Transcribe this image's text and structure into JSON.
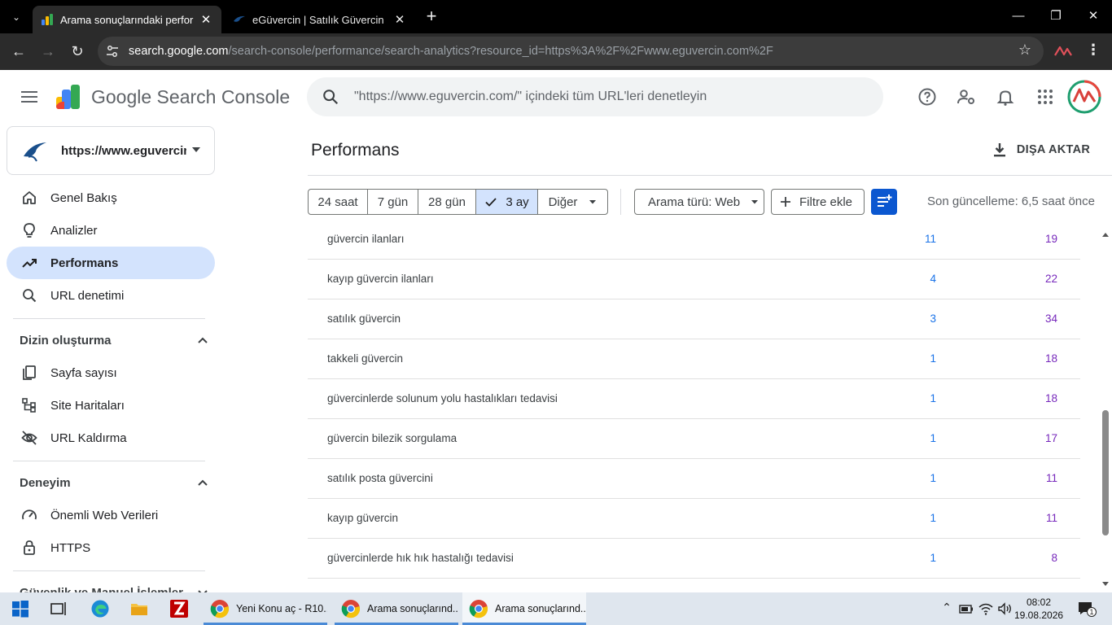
{
  "browser": {
    "tabs": [
      {
        "title": "Arama sonuçlarındaki performa",
        "active": true
      },
      {
        "title": "eGüvercin | Satılık Güvercin İlan",
        "active": false
      }
    ],
    "url_host": "search.google.com",
    "url_rest": "/search-console/performance/search-analytics?resource_id=https%3A%2F%2Fwww.eguvercin.com%2F"
  },
  "header": {
    "product": "Google Search Console",
    "search_placeholder": "\"https://www.eguvercin.com/\" içindeki tüm URL'leri denetleyin"
  },
  "sidebar": {
    "property": "https://www.eguvercin.com/",
    "items": [
      {
        "label": "Genel Bakış",
        "icon": "home-icon"
      },
      {
        "label": "Analizler",
        "icon": "lightbulb-icon"
      },
      {
        "label": "Performans",
        "icon": "trending-icon",
        "selected": true
      },
      {
        "label": "URL denetimi",
        "icon": "search-icon"
      }
    ],
    "section_index": {
      "title": "Dizin oluşturma",
      "items": [
        {
          "label": "Sayfa sayısı",
          "icon": "pages-icon"
        },
        {
          "label": "Site Haritaları",
          "icon": "sitemap-icon"
        },
        {
          "label": "URL Kaldırma",
          "icon": "eye-off-icon"
        }
      ]
    },
    "section_experience": {
      "title": "Deneyim",
      "items": [
        {
          "label": "Önemli Web Verileri",
          "icon": "speed-icon"
        },
        {
          "label": "HTTPS",
          "icon": "lock-icon"
        }
      ]
    },
    "section_security": {
      "title": "Güvenlik ve Manuel İşlemler"
    }
  },
  "main": {
    "title": "Performans",
    "export_label": "DIŞA AKTAR",
    "ranges": [
      "24 saat",
      "7 gün",
      "28 gün",
      "3 ay",
      "Diğer"
    ],
    "selected_range": "3 ay",
    "search_type": "Arama türü: Web",
    "add_filter": "Filtre ekle",
    "last_update": "Son güncelleme: 6,5 saat önce",
    "rows": [
      {
        "query": "güvercin ilanları",
        "clicks": "11",
        "impressions": "19"
      },
      {
        "query": "kayıp güvercin ilanları",
        "clicks": "4",
        "impressions": "22"
      },
      {
        "query": "satılık güvercin",
        "clicks": "3",
        "impressions": "34"
      },
      {
        "query": "takkeli güvercin",
        "clicks": "1",
        "impressions": "18"
      },
      {
        "query": "güvercinlerde solunum yolu hastalıkları tedavisi",
        "clicks": "1",
        "impressions": "18"
      },
      {
        "query": "güvercin bilezik sorgulama",
        "clicks": "1",
        "impressions": "17"
      },
      {
        "query": "satılık posta güvercini",
        "clicks": "1",
        "impressions": "11"
      },
      {
        "query": "kayıp güvercin",
        "clicks": "1",
        "impressions": "11"
      },
      {
        "query": "güvercinlerde hık hık hastalığı tedavisi",
        "clicks": "1",
        "impressions": "8"
      }
    ]
  },
  "taskbar": {
    "apps": [
      {
        "label": "Yeni Konu aç - R10...."
      },
      {
        "label": "Arama sonuçlarınd..."
      },
      {
        "label": "Arama sonuçlarınd...",
        "active": true
      }
    ],
    "time": "08:02",
    "date": "19.08.2026",
    "notification_count": "1"
  },
  "colors": {
    "accent": "#0b57d0",
    "selected_bg": "#d3e3fd",
    "clicks": "#1a73e8",
    "impressions": "#7627bb"
  }
}
